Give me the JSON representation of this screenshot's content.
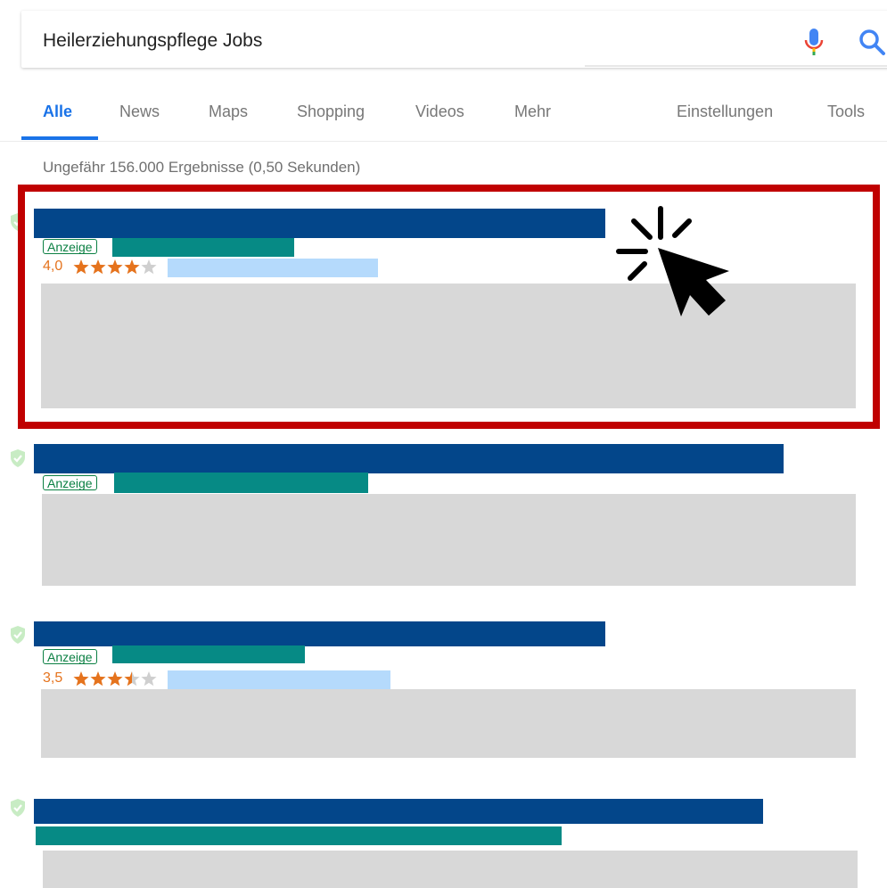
{
  "search": {
    "query": "Heilerziehungspflege Jobs",
    "mic_icon": "microphone-icon",
    "search_icon": "search-icon"
  },
  "tabs": [
    {
      "label": "Alle",
      "active": true
    },
    {
      "label": "News"
    },
    {
      "label": "Maps"
    },
    {
      "label": "Shopping"
    },
    {
      "label": "Videos"
    },
    {
      "label": "Mehr"
    },
    {
      "label": "Einstellungen"
    },
    {
      "label": "Tools"
    }
  ],
  "stats": "Ungefähr 156.000 Ergebnisse (0,50 Sekunden)",
  "results": [
    {
      "ad_label": "Anzeige",
      "rating": "4,0",
      "rating_value": 4.0,
      "rating_max": 5
    },
    {
      "ad_label": "Anzeige"
    },
    {
      "ad_label": "Anzeige",
      "rating": "3,5",
      "rating_value": 3.5,
      "rating_max": 5
    },
    {}
  ],
  "colors": {
    "accent_blue": "#1a73e8",
    "title_blue": "#03468a",
    "url_teal": "#068a85",
    "ad_green": "#0b8043",
    "rating_orange": "#e5731d",
    "highlight_red": "#c00000"
  },
  "icons": {
    "cursor": "click-cursor-icon",
    "shield": "shield-check-icon",
    "star": "star-icon"
  }
}
